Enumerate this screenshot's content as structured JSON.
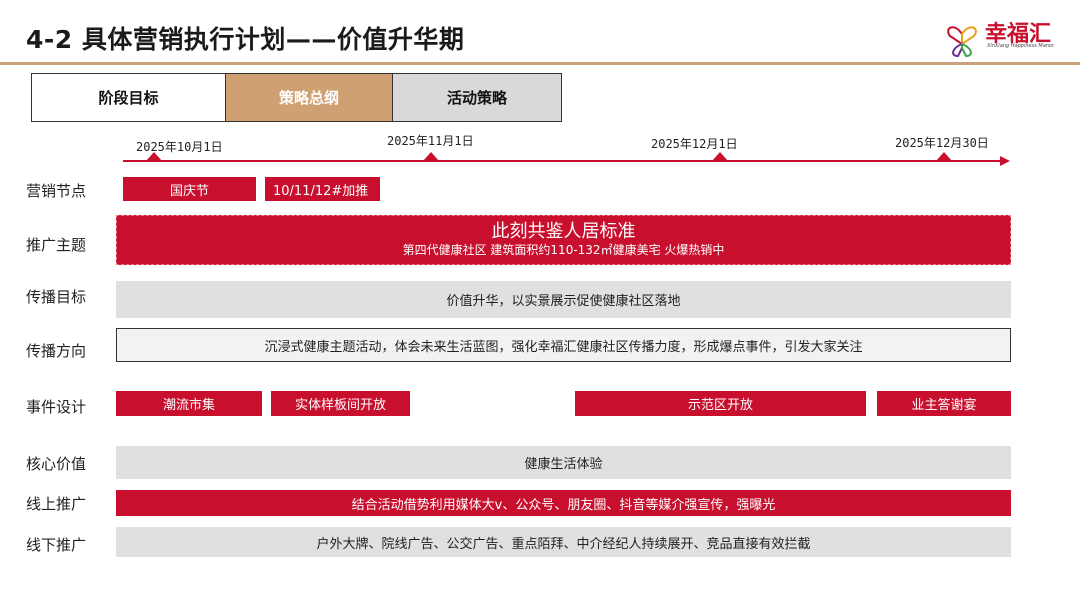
{
  "header": {
    "title": "4-2 具体营销执行计划——价值升华期",
    "logo_text": "幸福汇",
    "logo_subtext": "XinXiang Happiness Manor"
  },
  "tabs": [
    "阶段目标",
    "策略总纲",
    "活动策略"
  ],
  "timeline": {
    "dates": [
      "2025年10月1日",
      "2025年11月1日",
      "2025年12月1日",
      "2025年12月30日"
    ]
  },
  "rows": {
    "marketing_nodes": {
      "label": "营销节点",
      "items": [
        "国庆节",
        "10/11/12#加推"
      ]
    },
    "promo_theme": {
      "label": "推广主题",
      "main": "此刻共鉴人居标准",
      "sub": "第四代健康社区 建筑面积约110-132㎡健康美宅 火爆热销中"
    },
    "comm_goal": {
      "label": "传播目标",
      "text": "价值升华，以实景展示促使健康社区落地"
    },
    "comm_direction": {
      "label": "传播方向",
      "text": "沉浸式健康主题活动，体会未来生活蓝图，强化幸福汇健康社区传播力度，形成爆点事件，引发大家关注"
    },
    "event_design": {
      "label": "事件设计",
      "items": [
        "潮流市集",
        "实体样板间开放",
        "示范区开放",
        "业主答谢宴"
      ]
    },
    "core_value": {
      "label": "核心价值",
      "text": "健康生活体验"
    },
    "online_promo": {
      "label": "线上推广",
      "text": "结合活动借势利用媒体大v、公众号、朋友圈、抖音等媒介强宣传，强曝光"
    },
    "offline_promo": {
      "label": "线下推广",
      "text": "户外大牌、院线广告、公交广告、重点陌拜、中介经纪人持续展开、竞品直接有效拦截"
    }
  },
  "colors": {
    "accent_red": "#c8102e",
    "tab_gold": "#cfa072",
    "rule_gold": "#c9a27a",
    "bar_gray": "#e0e0e0"
  }
}
